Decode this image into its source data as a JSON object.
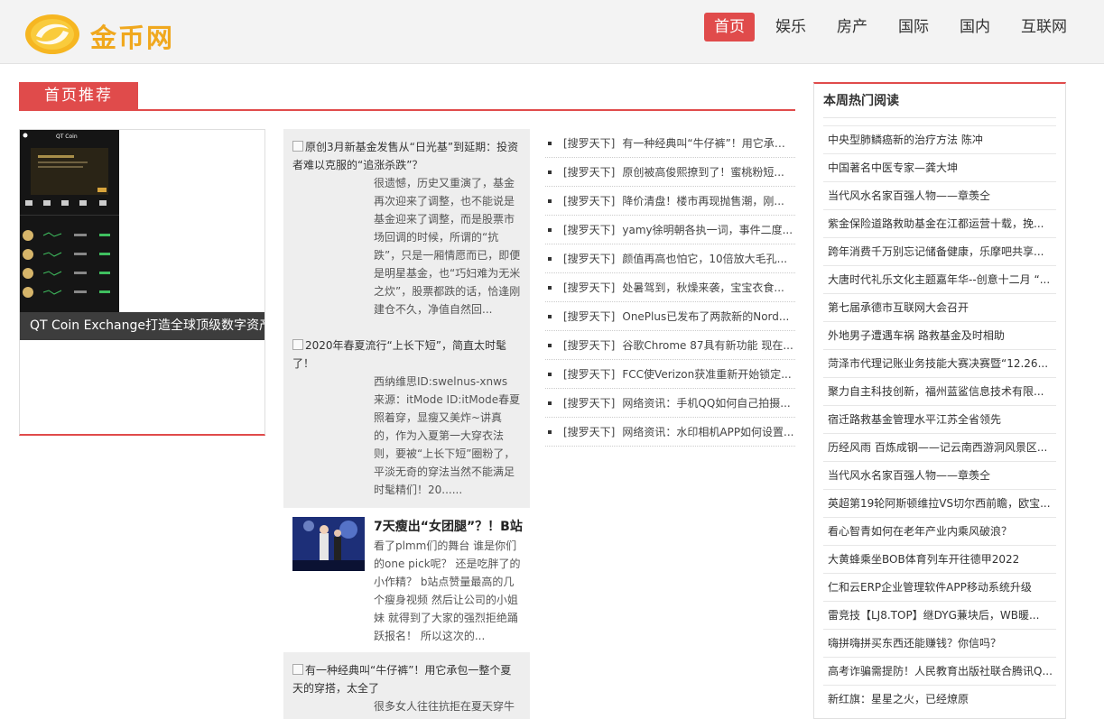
{
  "site": {
    "logo_text": "金币网"
  },
  "nav": [
    {
      "label": "首页",
      "active": true
    },
    {
      "label": "娱乐"
    },
    {
      "label": "房产"
    },
    {
      "label": "国际"
    },
    {
      "label": "国内"
    },
    {
      "label": "互联网"
    }
  ],
  "section": {
    "title": "首页推荐"
  },
  "featured": {
    "caption": "QT Coin Exchange打造全球顶级数字资产",
    "phone_title": "QT Coin"
  },
  "articles": [
    {
      "title": "原创3月新基金发售从“日光基”到延期：投资者难以克服的“追涨杀跌”？",
      "body": "很遗憾，历史又重演了，基金再次迎来了调整，也不能说是基金迎来了调整，而是股票市场回调的时候，所谓的“抗跌”，只是一厢情愿而已，即便是明星基金，也“巧妇难为无米之炊”，股票都跌的话，恰逢刚建仓不久，净值自然回..."
    },
    {
      "title": "2020年春夏流行“上长下短”，简直太时髦了！",
      "body": "西纳维思ID:swelnus-xnws 来源：itMode ID:itMode春夏照着穿，显瘦又美炸~讲真的，作为入夏第一大穿衣法则，要被“上长下短”圈粉了，平淡无奇的穿法当然不能满足时髦精们！20......"
    },
    {
      "title": "7天瘦出“女团腿”？！B站",
      "body": "看了plmm们的舞台 谁是你们的one pick呢？ 还是吃胖了的小作精？ b站点赞量最高的几个瘦身视频 然后让公司的小姐妹 就得到了大家的强烈拒绝踊跃报名！ 所以这次的..."
    },
    {
      "title": "有一种经典叫“牛仔裤”！用它承包一整个夏天的穿搭，太全了",
      "body": "很多女人往往抗拒在夏天穿牛"
    }
  ],
  "news": [
    {
      "tag": "[搜罗天下]",
      "text": "有一种经典叫“牛仔裤”！用它承包..."
    },
    {
      "tag": "[搜罗天下]",
      "text": "原创被高俊熙撩到了！蜜桃粉短..."
    },
    {
      "tag": "[搜罗天下]",
      "text": "降价清盘！楼市再现抛售潮，刚..."
    },
    {
      "tag": "[搜罗天下]",
      "text": "yamy徐明朝各执一词，事件二度..."
    },
    {
      "tag": "[搜罗天下]",
      "text": "颜值再高也怕它，10倍放大毛孔..."
    },
    {
      "tag": "[搜罗天下]",
      "text": "处暑驾到，秋燥来袭，宝宝衣食..."
    },
    {
      "tag": "[搜罗天下]",
      "text": "OnePlus已发布了两款新的Nord..."
    },
    {
      "tag": "[搜罗天下]",
      "text": "谷歌Chrome 87具有新功能 现在..."
    },
    {
      "tag": "[搜罗天下]",
      "text": "FCC使Verizon获准重新开始锁定..."
    },
    {
      "tag": "[搜罗天下]",
      "text": "网络资讯：手机QQ如何自己拍摄..."
    },
    {
      "tag": "[搜罗天下]",
      "text": "网络资讯：水印相机APP如何设置..."
    }
  ],
  "sidebar": {
    "title": "本周热门阅读",
    "items": [
      "中央型肺鳞癌新的治疗方法 陈冲",
      "中国著名中医专家—龚大坤",
      "当代风水名家百强人物——章羡仝",
      "紫金保险道路救助基金在江都运营十载，挽...",
      "跨年消费千万别忘记储备健康，乐摩吧共享...",
      "大唐时代礼乐文化主题嘉年华--创意十二月 “...",
      "第七届承德市互联网大会召开",
      "外地男子遭遇车祸 路救基金及时相助",
      "菏泽市代理记账业务技能大赛决赛暨“12.26...",
      "聚力自主科技创新，福州蓝鲨信息技术有限...",
      "宿迁路救基金管理水平江苏全省领先",
      "历经风雨 百炼成钢——记云南西游洞风景区...",
      "当代风水名家百强人物——章羡仝",
      "英超第19轮阿斯顿维拉VS切尔西前瞻，欧宝...",
      "看心智青如何在老年产业内乘风破浪？",
      "大黄蜂乘坐BOB体育列车开往德甲2022",
      "仁和云ERP企业管理软件APP移动系统升级",
      "雷竞技【LJ8.TOP】继DYG蒹块后，WB暖...",
      "嗨拼嗨拼买东西还能赚钱？你信吗？",
      "高考诈骗需提防！人民教育出版社联合腾讯Q...",
      "新红旗：星星之火，已经燎原"
    ]
  }
}
